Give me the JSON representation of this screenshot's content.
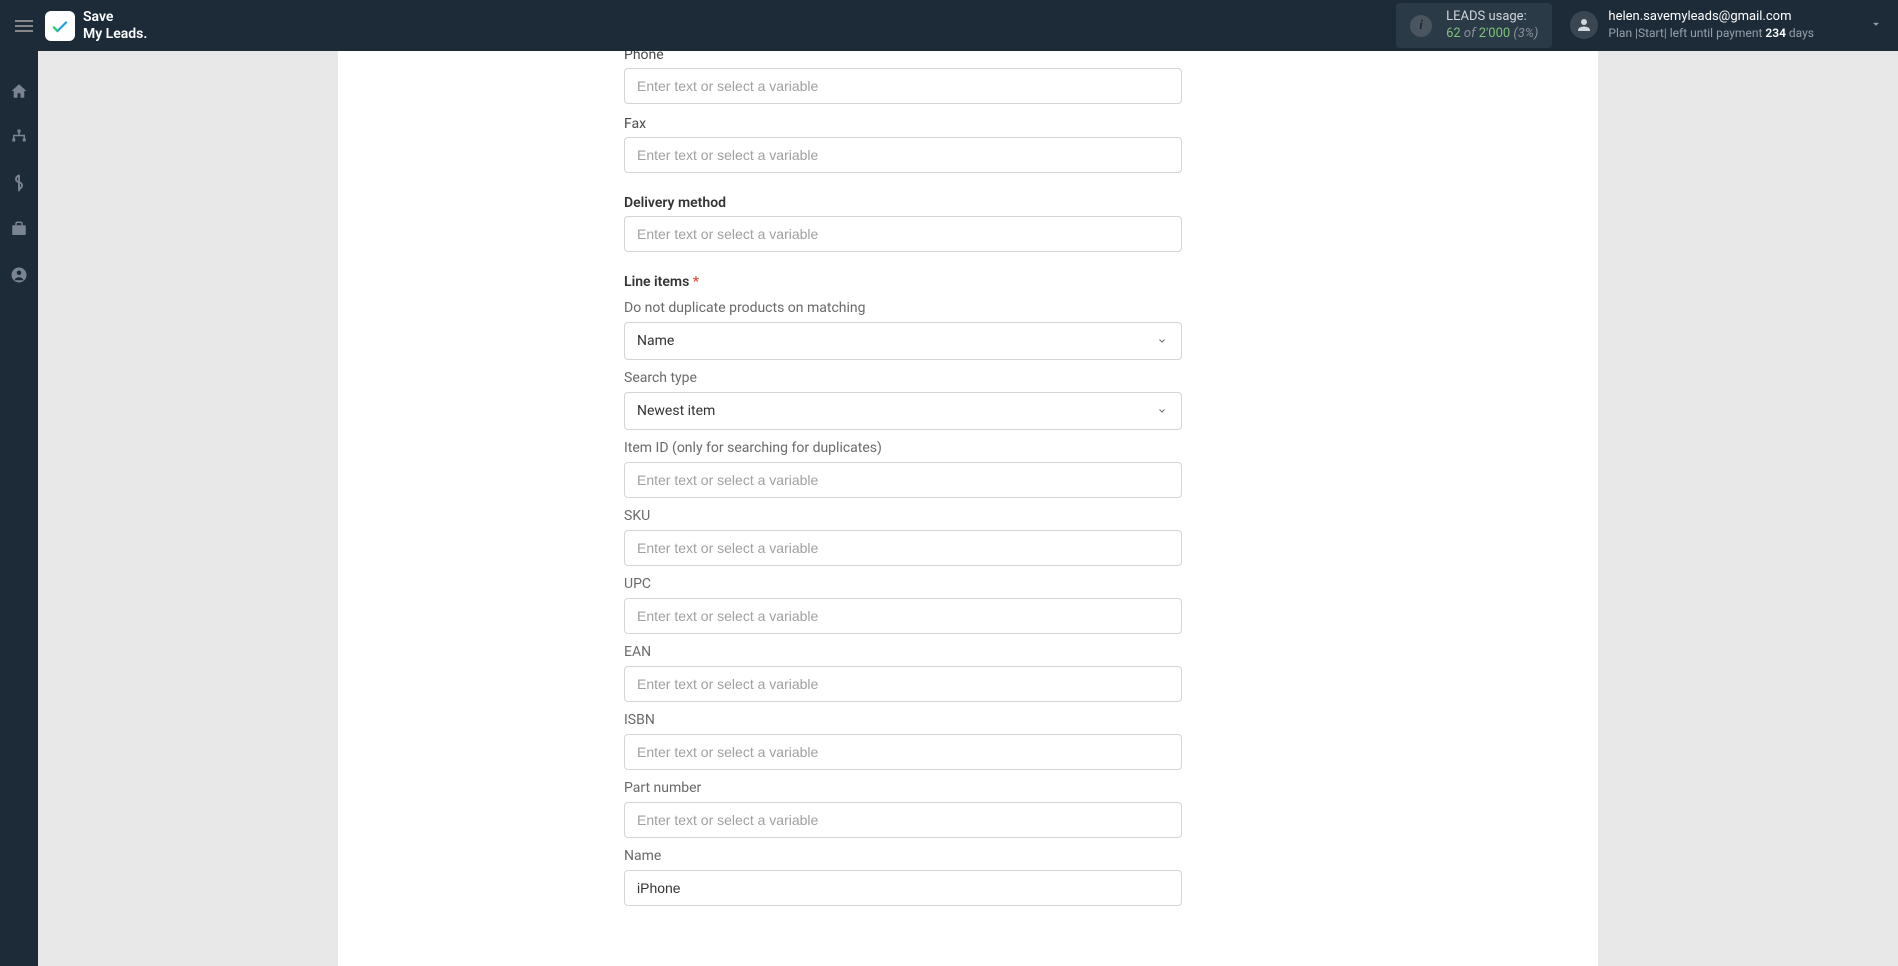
{
  "header": {
    "logo_line1": "Save",
    "logo_line2": "My Leads.",
    "usage_label": "LEADS usage:",
    "usage_current": "62",
    "usage_of": " of ",
    "usage_total": "2'000",
    "usage_pct": " (3%)",
    "email": "helen.savemyleads@gmail.com",
    "plan_prefix": "Plan |Start| left until payment ",
    "plan_days": "234",
    "plan_suffix": " days"
  },
  "form": {
    "phone_label": "Phone",
    "fax_label": "Fax",
    "delivery_method_label": "Delivery method",
    "line_items_label": "Line items",
    "do_not_duplicate_label": "Do not duplicate products on matching",
    "name_select_value": "Name",
    "search_type_label": "Search type",
    "search_type_value": "Newest item",
    "item_id_label": "Item ID (only for searching for duplicates)",
    "sku_label": "SKU",
    "upc_label": "UPC",
    "ean_label": "EAN",
    "isbn_label": "ISBN",
    "part_number_label": "Part number",
    "name_label": "Name",
    "name_value": "iPhone",
    "placeholder": "Enter text or select a variable"
  }
}
